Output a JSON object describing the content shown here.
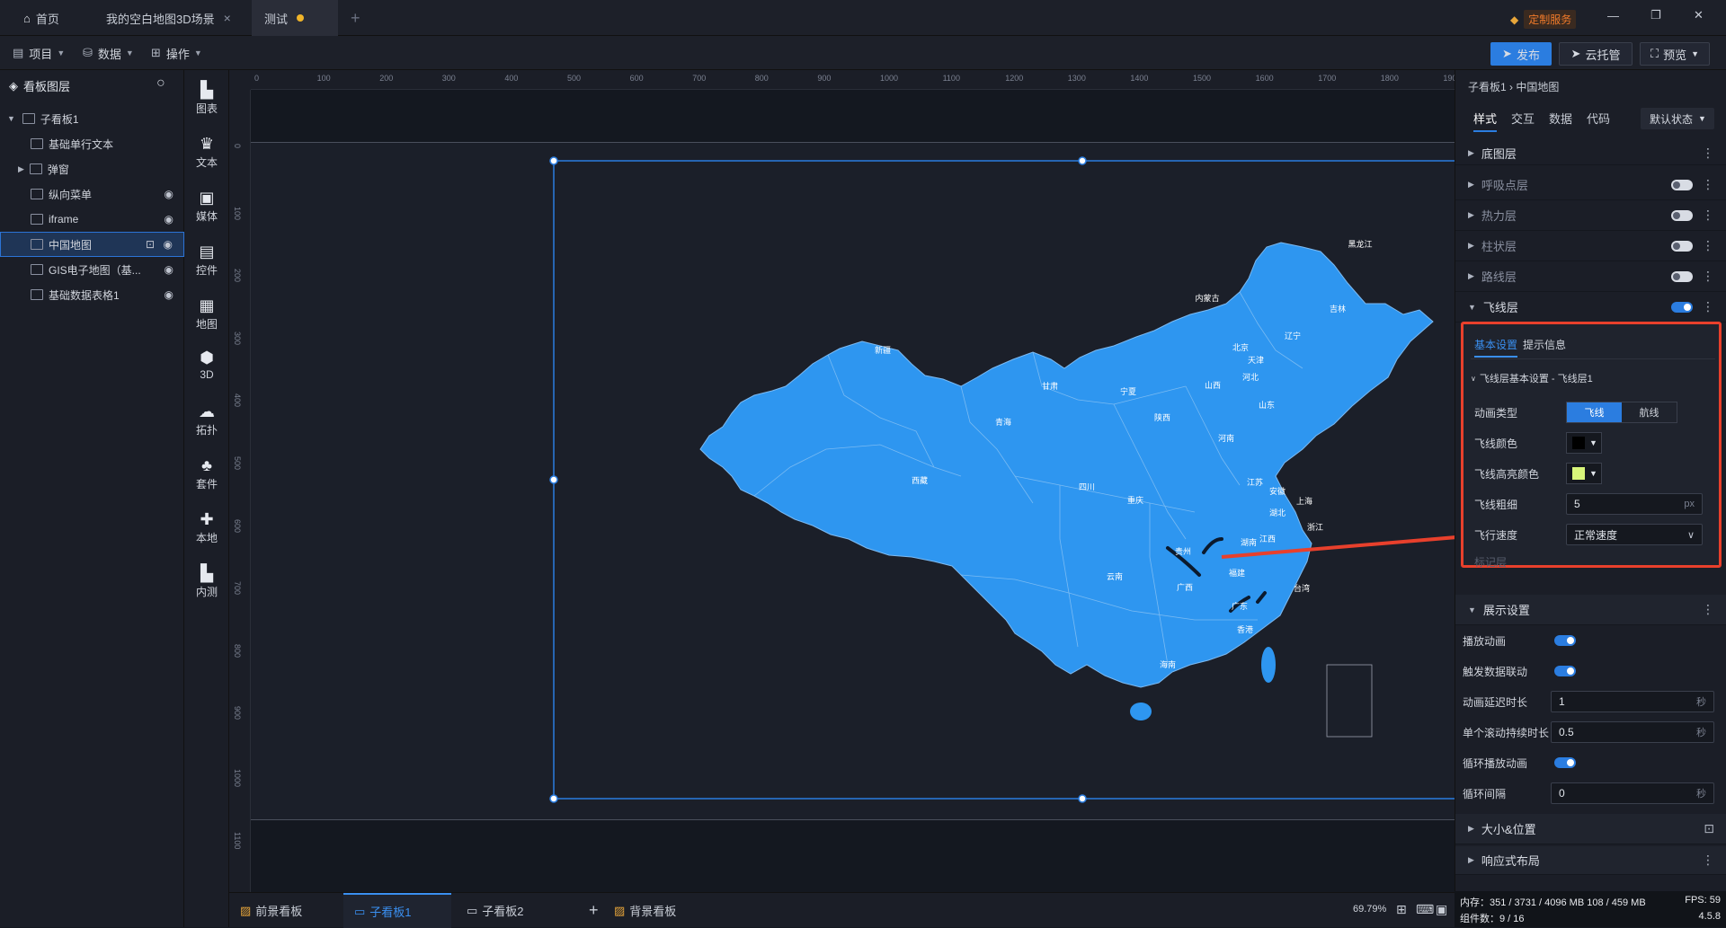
{
  "titlebar": {
    "tabs": [
      {
        "label": "首页",
        "icon": "home-icon"
      },
      {
        "label": "我的空白地图3D场景",
        "close": "×"
      },
      {
        "label": "测试"
      }
    ],
    "new_tab": "+",
    "custom_service": "定制服务",
    "window_controls": {
      "minimize": "—",
      "restore": "❐",
      "close": "✕"
    }
  },
  "menubar": {
    "items": [
      "项目",
      "数据",
      "操作"
    ],
    "publish": "发布",
    "cloud": "云托管",
    "preview": "预览"
  },
  "layers": {
    "title": "看板图层",
    "root": "子看板1",
    "items": [
      "基础单行文本",
      "弹窗",
      "纵向菜单",
      "iframe",
      "中国地图",
      "GIS电子地图（基...",
      "基础数据表格1"
    ]
  },
  "iconbar": {
    "items": [
      "图表",
      "文本",
      "媒体",
      "控件",
      "地图",
      "3D",
      "拓扑",
      "套件",
      "本地",
      "内测"
    ]
  },
  "ruler": {
    "top_ticks": [
      "0",
      "100",
      "200",
      "300",
      "400",
      "500",
      "600",
      "700",
      "800",
      "900",
      "1000",
      "1100",
      "1200",
      "1300",
      "1400",
      "1500",
      "1600",
      "1700",
      "1800",
      "1900"
    ],
    "left_ticks": [
      "0",
      "100",
      "200",
      "300",
      "400",
      "500",
      "600",
      "700",
      "800",
      "900",
      "1000",
      "1100"
    ]
  },
  "map": {
    "provinces": [
      {
        "name": "新疆"
      },
      {
        "name": "西藏"
      },
      {
        "name": "青海"
      },
      {
        "name": "甘肃"
      },
      {
        "name": "内蒙古"
      },
      {
        "name": "黑龙江"
      },
      {
        "name": "吉林"
      },
      {
        "name": "辽宁"
      },
      {
        "name": "北京"
      },
      {
        "name": "天津"
      },
      {
        "name": "河北"
      },
      {
        "name": "山西"
      },
      {
        "name": "宁夏"
      },
      {
        "name": "陕西"
      },
      {
        "name": "山东"
      },
      {
        "name": "河南"
      },
      {
        "name": "江苏"
      },
      {
        "name": "安徽"
      },
      {
        "name": "上海"
      },
      {
        "name": "湖北"
      },
      {
        "name": "四川"
      },
      {
        "name": "重庆"
      },
      {
        "name": "浙江"
      },
      {
        "name": "湖南"
      },
      {
        "name": "江西"
      },
      {
        "name": "贵州"
      },
      {
        "name": "云南"
      },
      {
        "name": "福建"
      },
      {
        "name": "台湾"
      },
      {
        "name": "广西"
      },
      {
        "name": "广东"
      },
      {
        "name": "香港"
      },
      {
        "name": "海南"
      }
    ],
    "map_color": "#2e96f0",
    "arrow_color": "#e8402c"
  },
  "bottombar": {
    "tabs": [
      "前景看板",
      "子看板1",
      "子看板2",
      "背景看板"
    ],
    "add": "+",
    "zoom": "69.79%"
  },
  "rpanel": {
    "breadcrumb": "子看板1 › 中国地图",
    "tabs": [
      "样式",
      "交互",
      "数据",
      "代码"
    ],
    "state": "默认状态",
    "layers": [
      "底图层",
      "呼吸点层",
      "热力层",
      "柱状层",
      "路线层",
      "飞线层"
    ],
    "subtabs": [
      "基本设置",
      "提示信息"
    ],
    "group_title": "飞线层基本设置 - 飞线层1",
    "anim_type_label": "动画类型",
    "anim_type_options": [
      "飞线",
      "航线"
    ],
    "line_color_label": "飞线颜色",
    "line_color": "#000000",
    "highlight_color_label": "飞线高亮颜色",
    "highlight_color": "#d8f57a",
    "thickness_label": "飞线粗细",
    "thickness_value": "5",
    "thickness_unit": "px",
    "speed_label": "飞行速度",
    "speed_value": "正常速度",
    "marker_layer": "标记层",
    "display_section": "展示设置",
    "play_anim": "播放动画",
    "trigger_link": "触发数据联动",
    "anim_delay": "动画延迟时长",
    "anim_delay_value": "1",
    "scroll_duration": "单个滚动持续时长",
    "scroll_duration_value": "0.5",
    "loop_anim": "循环播放动画",
    "loop_interval": "循环间隔",
    "loop_interval_value": "0",
    "sec_unit": "秒",
    "size_pos": "大小&位置",
    "responsive": "响应式布局",
    "highlight_border_color": "#e8402c"
  },
  "status": {
    "memory": "内存：351 / 3731 / 4096 MB  108 / 459 MB",
    "fps": "FPS: 59",
    "components": "组件数：9 / 16",
    "version": "4.5.8"
  }
}
